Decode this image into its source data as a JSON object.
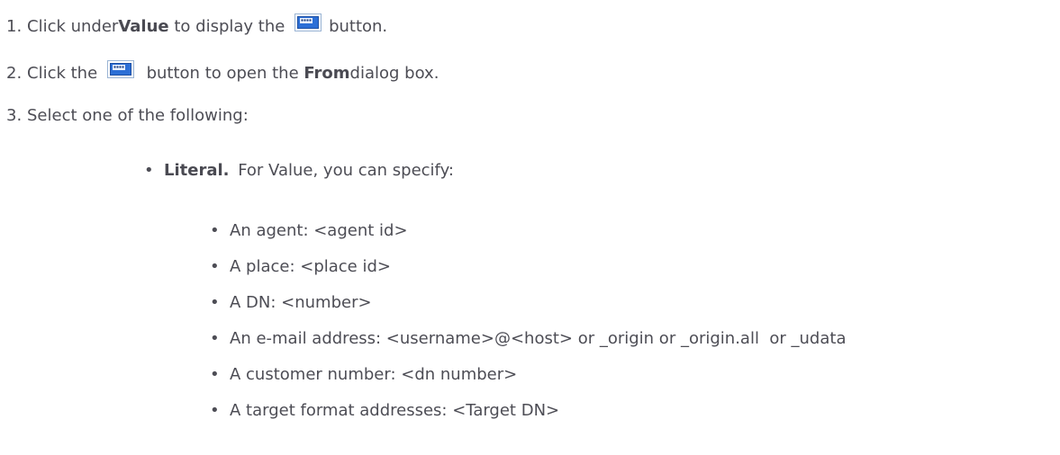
{
  "steps": [
    {
      "num": "1.",
      "pre": "Click under ",
      "bold": "Value",
      "mid": " to display the ",
      "post": " button."
    },
    {
      "num": "2.",
      "pre": "Click the ",
      "mid": " button to open the ",
      "bold": "From",
      "post": " dialog box."
    },
    {
      "num": "3.",
      "text": "Select one of the following:"
    }
  ],
  "option": {
    "bullet": "•",
    "bold": "Literal.",
    "text": " For Value, you can specify:"
  },
  "subitems": [
    "An agent: <agent id>",
    "A place: <place id>",
    "A DN: <number>",
    "An e-mail address: <username>@<host> or _origin or _origin.all  or _udata",
    "A customer number: <dn number>",
    "A target format addresses: <Target DN>"
  ],
  "icons": {
    "value_button": "ellipsis-button-icon"
  },
  "colors": {
    "text": "#4d4d55",
    "icon_blue": "#2c6fd6"
  }
}
